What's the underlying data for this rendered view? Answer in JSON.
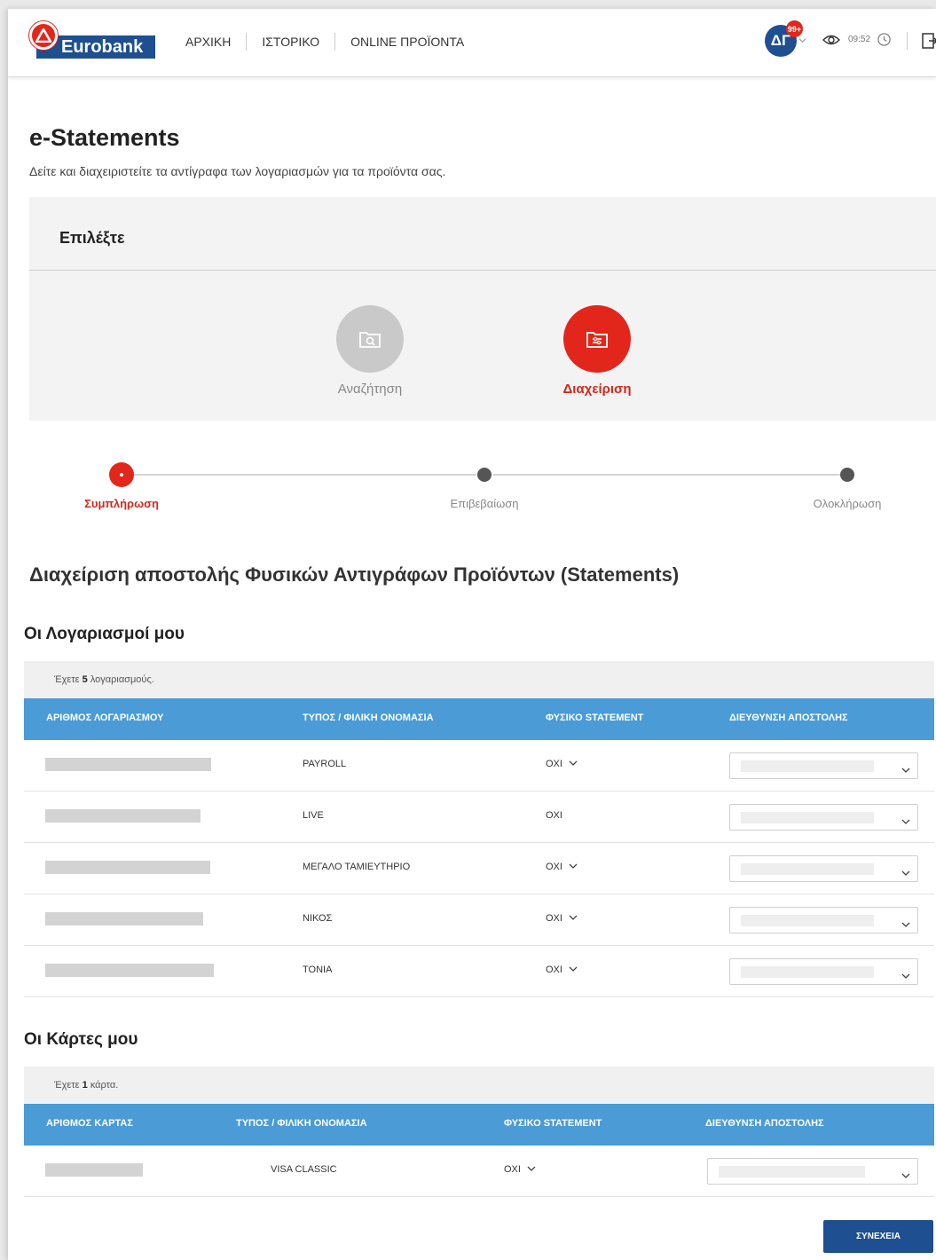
{
  "header": {
    "logo_text": "Eurobank",
    "nav": [
      "ΑΡΧΙΚΗ",
      "ΙΣΤΟΡΙΚΟ",
      "ONLINE ΠΡΟΪΟΝΤΑ"
    ],
    "avatar_initials": "ΔΓ",
    "notifications": "99+",
    "time": "09:52"
  },
  "page": {
    "title": "e-Statements",
    "subtitle": "Δείτε και διαχειριστείτε τα αντίγραφα των λογαριασμών για τα προϊόντα σας."
  },
  "select": {
    "heading": "Επιλέξτε",
    "options": [
      {
        "label": "Αναζήτηση",
        "active": false
      },
      {
        "label": "Διαχείριση",
        "active": true
      }
    ]
  },
  "stepper": {
    "steps": [
      {
        "label": "Συμπλήρωση",
        "active": true
      },
      {
        "label": "Επιβεβαίωση",
        "active": false
      },
      {
        "label": "Ολοκλήρωση",
        "active": false
      }
    ]
  },
  "section_title": "Διαχείριση αποστολής Φυσικών Αντιγράφων Προϊόντων (Statements)",
  "accounts": {
    "title": "Οι Λογαριασμοί μου",
    "count_prefix": "Έχετε",
    "count": "5",
    "count_suffix": "λογαριασμούς.",
    "headers": [
      "ΑΡΙΘΜΟΣ ΛΟΓΑΡΙΑΣΜΟΥ",
      "ΤΥΠΟΣ / ΦΙΛΙΚΗ ΟΝΟΜΑΣΙΑ",
      "ΦΥΣΙΚΟ STATEMENT",
      "ΔΙΕΥΘΥΝΣΗ ΑΠΟΣΤΟΛΗΣ"
    ],
    "rows": [
      {
        "type": "PAYROLL",
        "statement": "ΟΧΙ",
        "dropdown": true
      },
      {
        "type": "LIVE",
        "statement": "ΟΧΙ",
        "dropdown": false
      },
      {
        "type": "ΜΕΓΑΛΟ ΤΑΜΙΕΥΤΗΡΙΟ",
        "statement": "ΟΧΙ",
        "dropdown": true
      },
      {
        "type": "ΝΙΚΟΣ",
        "statement": "ΟΧΙ",
        "dropdown": true
      },
      {
        "type": "ΤΟΝΙΑ",
        "statement": "ΟΧΙ",
        "dropdown": true
      }
    ]
  },
  "cards": {
    "title": "Οι Κάρτες μου",
    "count_prefix": "Έχετε",
    "count": "1",
    "count_suffix": "κάρτα.",
    "headers": [
      "ΑΡΙΘΜΟΣ ΚΑΡΤΑΣ",
      "ΤΥΠΟΣ / ΦΙΛΙΚΗ ΟΝΟΜΑΣΙΑ",
      "ΦΥΣΙΚΟ STATEMENT",
      "ΔΙΕΥΘΥΝΣΗ ΑΠΟΣΤΟΛΗΣ"
    ],
    "rows": [
      {
        "type": "VISA CLASSIC",
        "statement": "ΟΧΙ",
        "dropdown": true
      }
    ]
  },
  "continue_label": "ΣΥΝΕΧΕΙΑ",
  "colors": {
    "brand_red": "#e3261b",
    "brand_blue": "#1d4f91",
    "table_header": "#4a9bd6"
  }
}
